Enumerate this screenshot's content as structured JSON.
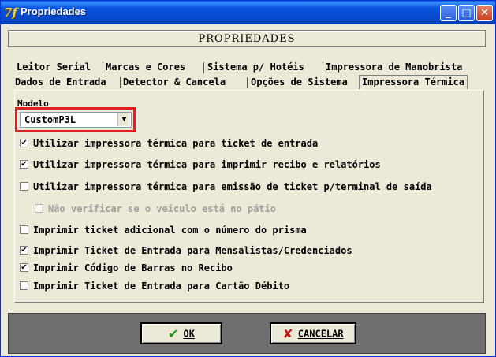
{
  "window": {
    "title": "Propriedades",
    "app_icon_glyph": "7f"
  },
  "header": {
    "title": "PROPRIEDADES"
  },
  "tabs": [
    {
      "label": "Leitor Serial"
    },
    {
      "label": "Marcas e Cores"
    },
    {
      "label": "Sistema p/ Hotéis"
    },
    {
      "label": "Impressora de Manobrista"
    },
    {
      "label": "Dados de Entrada"
    },
    {
      "label": "Detector & Cancela"
    },
    {
      "label": "Opções de Sistema"
    },
    {
      "label": "Impressora Térmica",
      "active": true
    }
  ],
  "modelo": {
    "label": "Modelo",
    "selected": "CustomP3L"
  },
  "options": [
    {
      "label": "Utilizar impressora térmica para ticket de entrada",
      "checked": true
    },
    {
      "label": "Utilizar impressora térmica para imprimir recibo e relatórios",
      "checked": true
    },
    {
      "label": "Utilizar impressora térmica para emissão de ticket p/terminal de saída",
      "checked": false
    },
    {
      "label": "Não verificar se o veículo está no pátio",
      "checked": false,
      "disabled": true
    },
    {
      "label": "Imprimir ticket adicional com o número do prisma",
      "checked": false
    },
    {
      "label": "Imprimir Ticket de Entrada para Mensalistas/Credenciados",
      "checked": true
    },
    {
      "label": "Imprimir Código de Barras no Recibo",
      "checked": true
    },
    {
      "label": "Imprimir Ticket de Entrada para Cartão Débito",
      "checked": false
    }
  ],
  "buttons": {
    "ok": "OK",
    "cancel": "CANCELAR"
  },
  "colors": {
    "highlight": "#e02020",
    "titlebar": "#0a55df"
  }
}
